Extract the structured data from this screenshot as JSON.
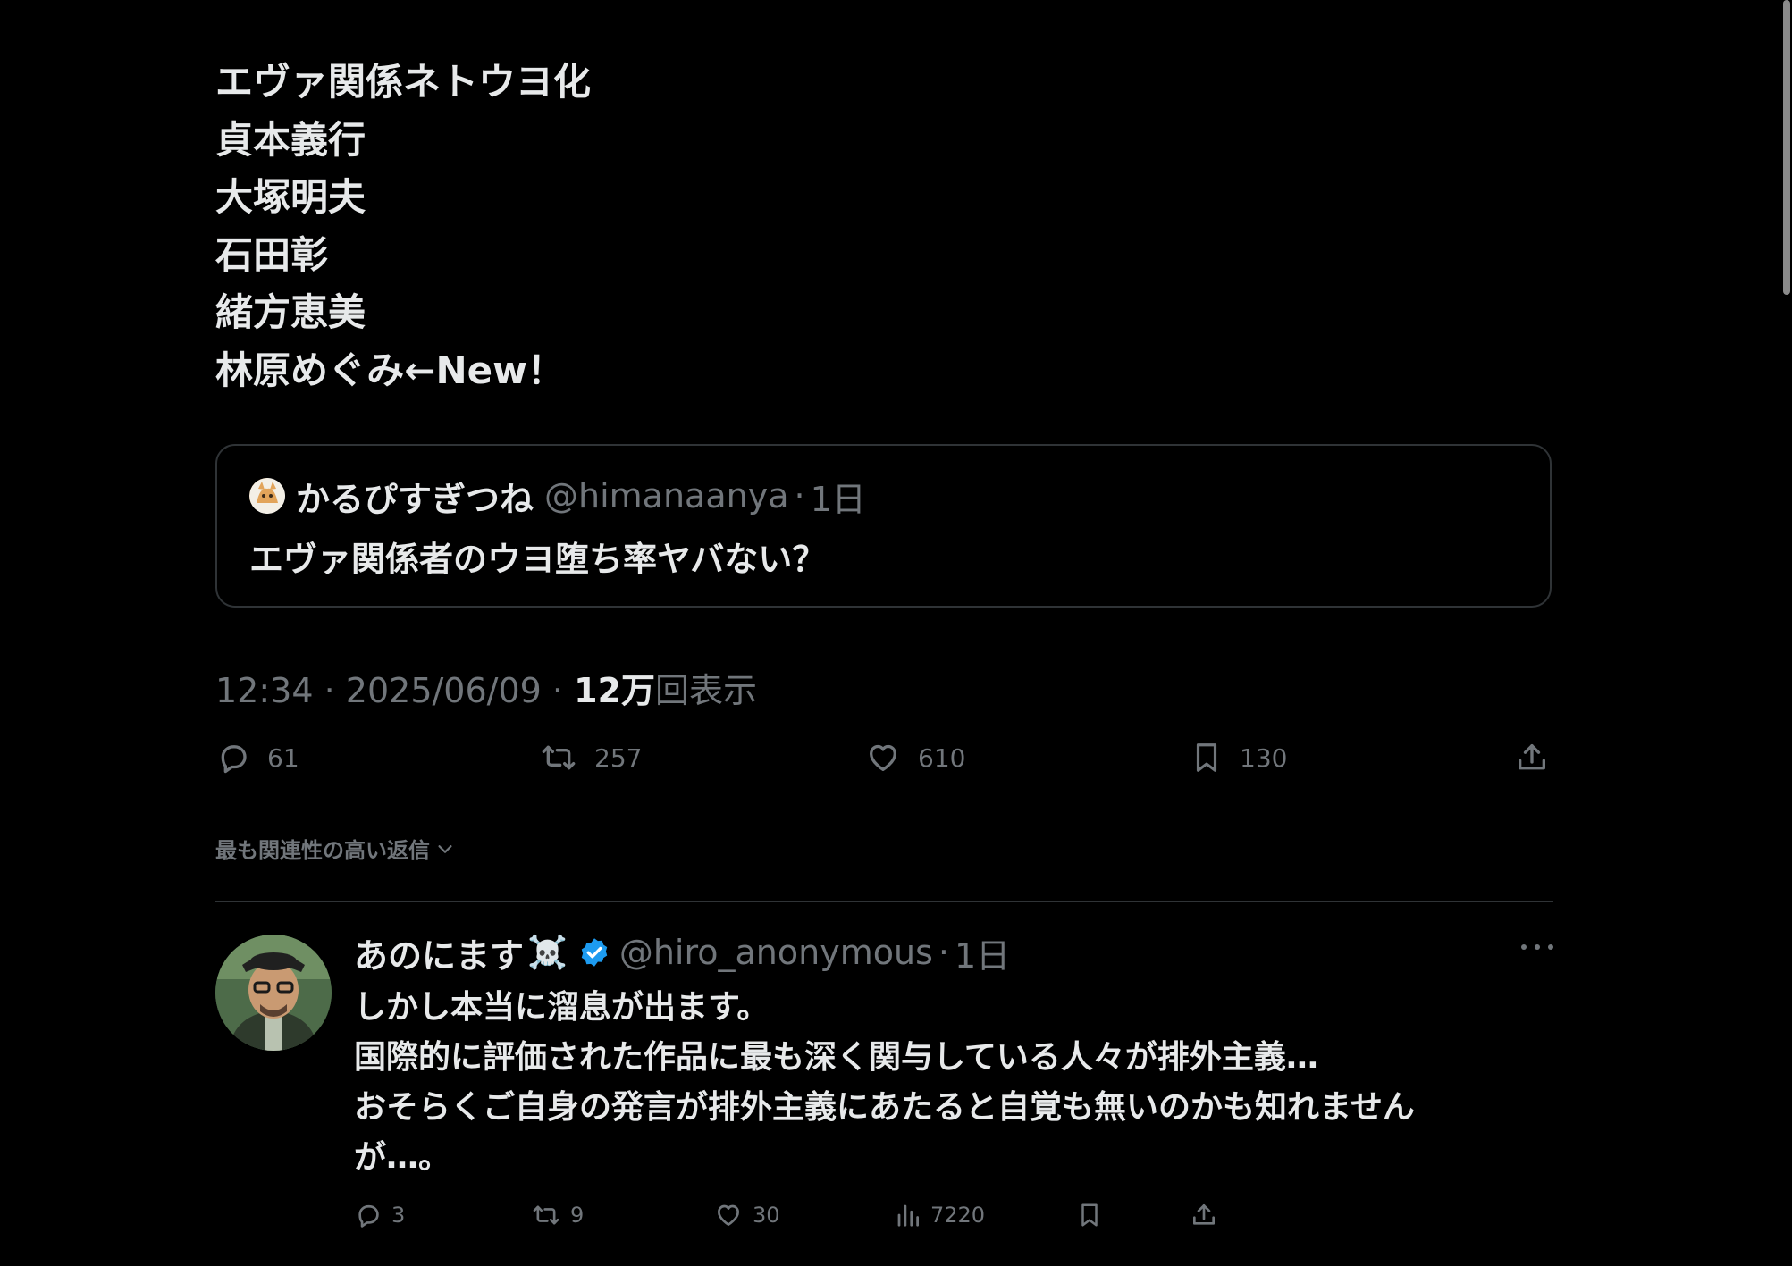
{
  "tweet": {
    "lines": [
      "エヴァ関係ネトウヨ化",
      "貞本義行",
      "大塚明夫",
      "石田彰",
      "緒方恵美",
      "林原めぐみ←New！"
    ],
    "quote": {
      "name": "かるぴすぎつね",
      "handle": "@himanaanya",
      "separator": "·",
      "time": "1日",
      "text": "エヴァ関係者のウヨ堕ち率ヤバない？"
    },
    "meta": {
      "time": "12:34",
      "separator": "·",
      "date": "2025/06/09",
      "views_count": "12万",
      "views_label": "回表示"
    },
    "actions": {
      "replies": "61",
      "retweets": "257",
      "likes": "610",
      "bookmarks": "130"
    }
  },
  "replies_sort": {
    "label": "最も関連性の高い返信"
  },
  "reply": {
    "name": "あのにます",
    "name_emoji": "☠️",
    "handle": "@hiro_anonymous",
    "separator": "·",
    "time": "1日",
    "lines": [
      "しかし本当に溜息が出ます。",
      "国際的に評価された作品に最も深く関与している人々が排外主義…",
      "おそらくご自身の発言が排外主義にあたると自覚も無いのかも知れません",
      "が…。"
    ],
    "actions": {
      "replies": "3",
      "retweets": "9",
      "likes": "30",
      "views": "7220"
    }
  },
  "colors": {
    "background": "#000000",
    "text": "#e7e9ea",
    "muted": "#71767b",
    "border": "#2f3336",
    "verified": "#1d9bf0"
  },
  "icons": {
    "reply": "reply-icon",
    "retweet": "retweet-icon",
    "like": "heart-icon",
    "bookmark": "bookmark-icon",
    "share": "share-icon",
    "views": "views-icon",
    "more": "more-icon",
    "verified": "verified-badge-icon",
    "chevron": "chevron-down-icon"
  }
}
